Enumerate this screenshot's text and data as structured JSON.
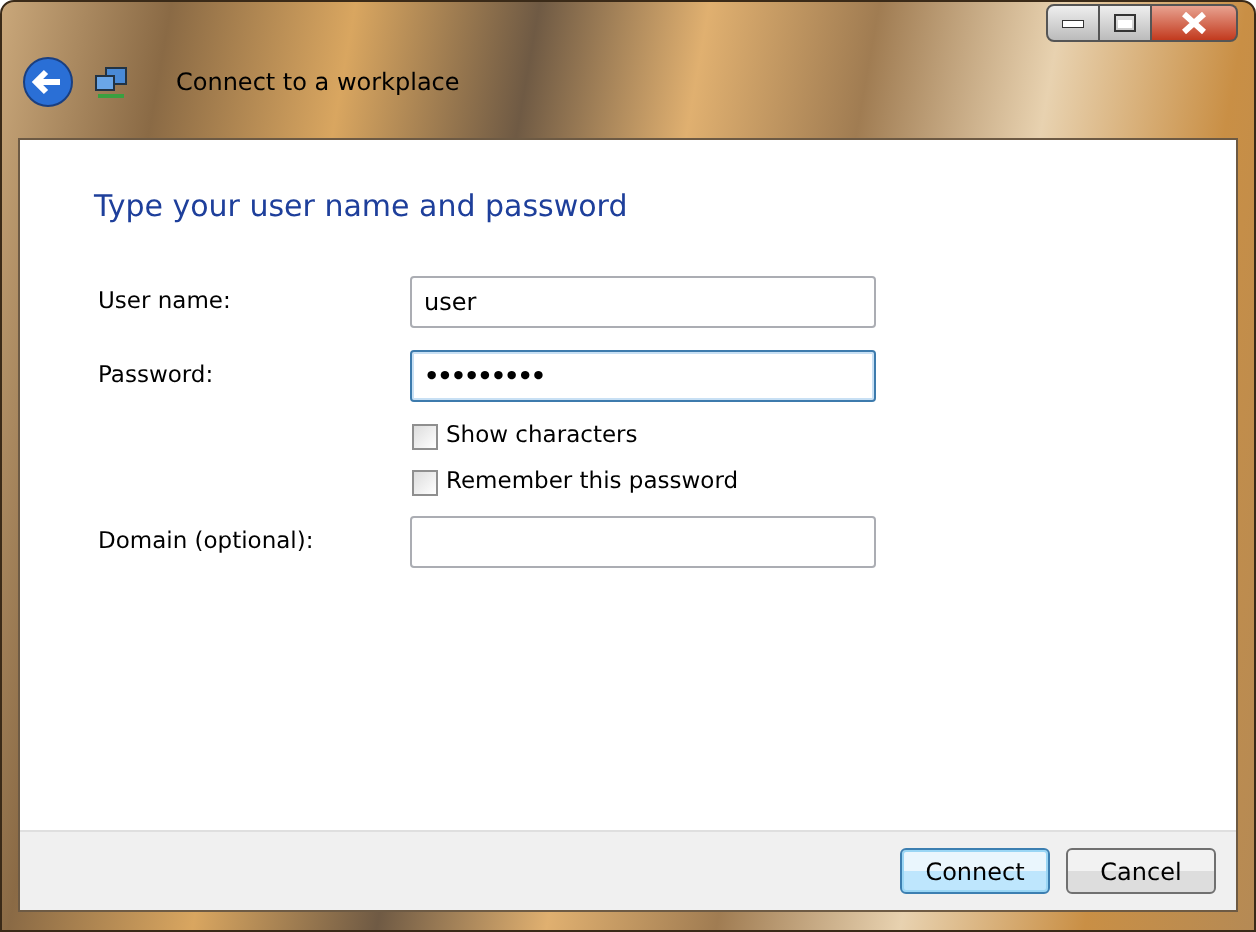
{
  "window": {
    "title": "Connect to a workplace"
  },
  "heading": "Type your user name and password",
  "fields": [
    {
      "kind": "text",
      "label": "User name:",
      "value": "user",
      "focused": false
    },
    {
      "kind": "password",
      "label": "Password:",
      "value": "•••••••••",
      "focused": true
    },
    {
      "kind": "checkbox",
      "label": "Show characters",
      "checked": false
    },
    {
      "kind": "checkbox",
      "label": "Remember this password",
      "checked": false
    },
    {
      "kind": "text",
      "label": "Domain (optional):",
      "focused": false
    }
  ],
  "buttons": [
    {
      "label": "Connect",
      "default": true
    },
    {
      "label": "Cancel",
      "default": false
    }
  ]
}
